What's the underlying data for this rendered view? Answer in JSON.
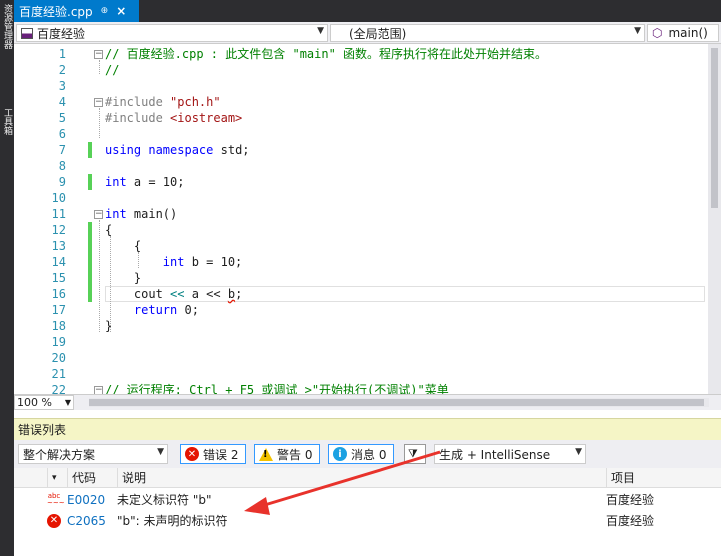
{
  "side_panel": {
    "labels": [
      "资源管理器",
      "工具箱"
    ]
  },
  "tab": {
    "filename": "百度经验.cpp",
    "pin_glyph": "⊕",
    "close_glyph": "×"
  },
  "navbar": {
    "project": "百度经验",
    "scope": "(全局范围)",
    "function": "main()"
  },
  "code_lines": [
    {
      "n": "1",
      "text": "// 百度经验.cpp : 此文件包含 \"main\" 函数。程序执行将在此处开始并结束。"
    },
    {
      "n": "2",
      "text": "//"
    },
    {
      "n": "3",
      "text": ""
    },
    {
      "n": "4",
      "text": "#include \"pch.h\""
    },
    {
      "n": "5",
      "text": "#include <iostream>"
    },
    {
      "n": "6",
      "text": ""
    },
    {
      "n": "7",
      "text": "using namespace std;"
    },
    {
      "n": "8",
      "text": ""
    },
    {
      "n": "9",
      "text": "int a = 10;"
    },
    {
      "n": "10",
      "text": ""
    },
    {
      "n": "11",
      "text": "int main()"
    },
    {
      "n": "12",
      "text": "{"
    },
    {
      "n": "13",
      "text": "    {"
    },
    {
      "n": "14",
      "text": "        int b = 10;"
    },
    {
      "n": "15",
      "text": "    }"
    },
    {
      "n": "16",
      "text": "    cout << a << b;"
    },
    {
      "n": "17",
      "text": "    return 0;"
    },
    {
      "n": "18",
      "text": "}"
    },
    {
      "n": "19",
      "text": ""
    },
    {
      "n": "20",
      "text": ""
    },
    {
      "n": "21",
      "text": ""
    },
    {
      "n": "22",
      "text": "// 运行程序: Ctrl + F5 或调试 >\"开始执行(不调试)\"菜单"
    }
  ],
  "zoom": "100 %",
  "error_list": {
    "title": "错误列表",
    "scope_filter": "整个解决方案",
    "errors_btn": "错误 2",
    "warnings_btn": "警告 0",
    "messages_btn": "消息 0",
    "build_filter": "生成 + IntelliSense",
    "columns": {
      "code": "代码",
      "description": "说明",
      "project": "项目"
    },
    "rows": [
      {
        "code": "E0020",
        "description": "未定义标识符 \"b\"",
        "project": "百度经验",
        "icon": "intellisense-squiggle-icon"
      },
      {
        "code": "C2065",
        "description": "\"b\": 未声明的标识符",
        "project": "百度经验",
        "icon": "error-icon"
      }
    ]
  },
  "colors": {
    "accent": "#007acc",
    "annotation_arrow": "#e8322b",
    "changed_bar": "#57d157"
  }
}
